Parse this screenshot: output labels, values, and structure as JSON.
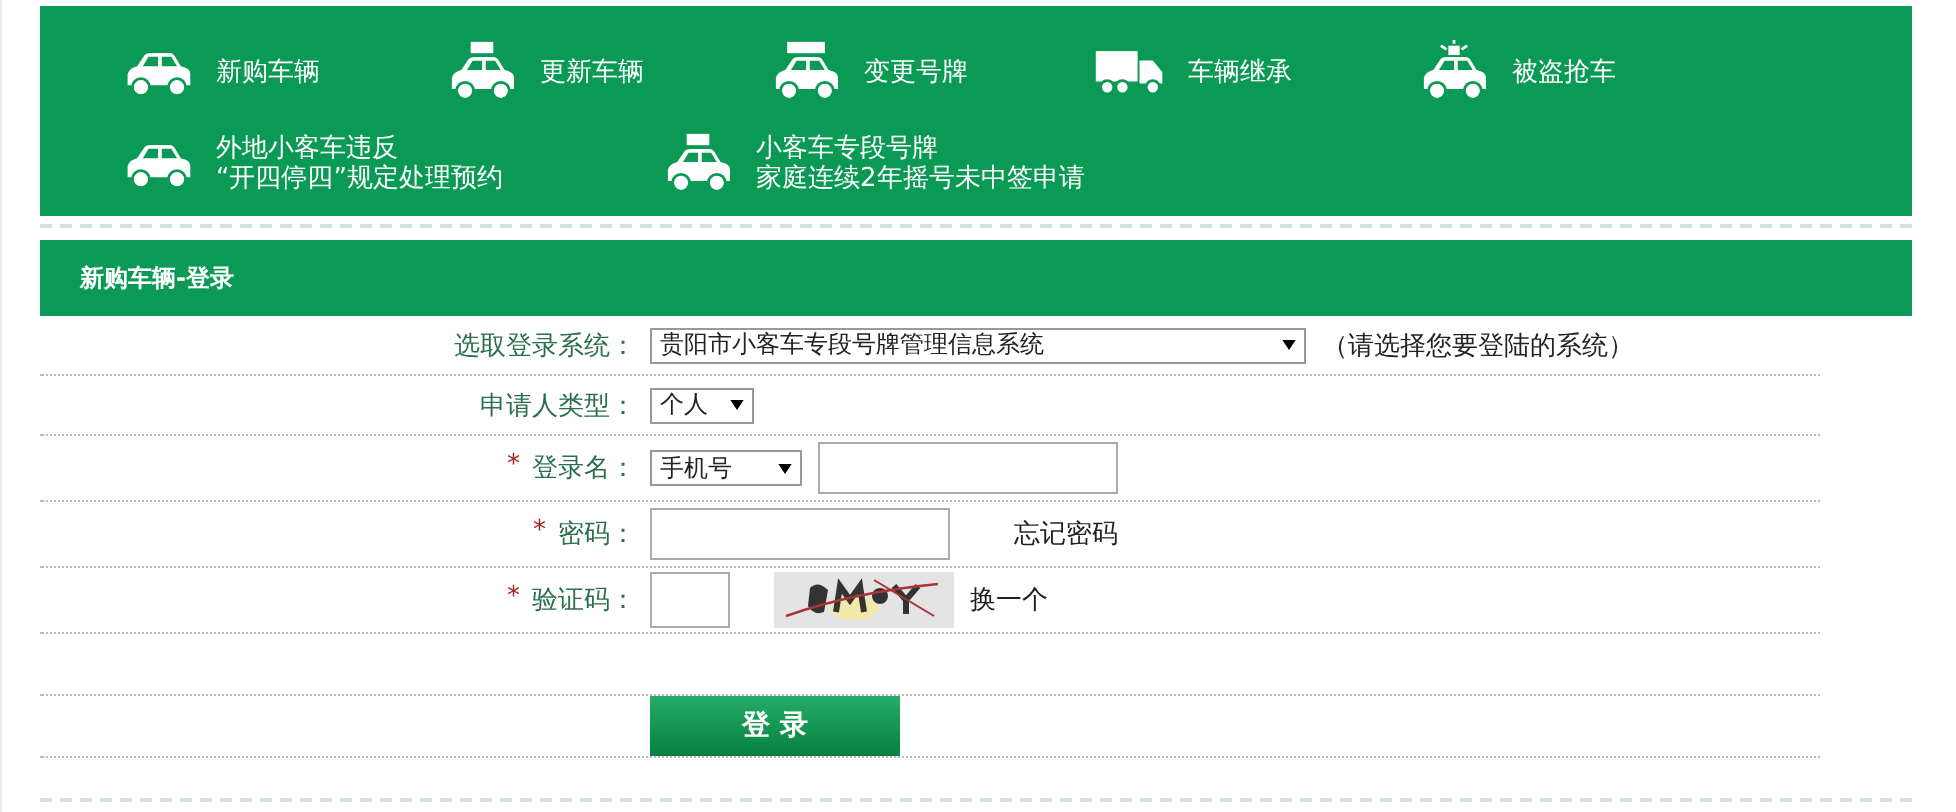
{
  "nav": {
    "items": [
      {
        "kind": "car",
        "lines": [
          "新购车辆"
        ]
      },
      {
        "kind": "taxi",
        "lines": [
          "更新车辆"
        ]
      },
      {
        "kind": "sign-car",
        "lines": [
          "变更号牌"
        ]
      },
      {
        "kind": "truck",
        "lines": [
          "车辆继承"
        ]
      },
      {
        "kind": "police",
        "lines": [
          "被盗抢车"
        ]
      },
      {
        "kind": "car",
        "lines": [
          "外地小客车违反",
          "“开四停四”规定处理预约"
        ]
      },
      {
        "kind": "taxi",
        "lines": [
          "小客车专段号牌",
          "家庭连续2年摇号未中签申请"
        ]
      }
    ]
  },
  "panel": {
    "title": "新购车辆-登录"
  },
  "form": {
    "rows": [
      {
        "kind": "select",
        "label": "选取登录系统：",
        "select": "贵阳市小客车专段号牌管理信息系统",
        "hint": "（请选择您要登陆的系统）"
      },
      {
        "kind": "select",
        "label": "申请人类型：",
        "select": "个人"
      },
      {
        "kind": "select-input",
        "mark": "*",
        "label": "登录名：",
        "select": "手机号"
      },
      {
        "kind": "password",
        "mark": "*",
        "label": "密码：",
        "link": "忘记密码"
      },
      {
        "kind": "captcha",
        "mark": "*",
        "label": "验证码：",
        "link": "换一个"
      },
      {
        "kind": "blank"
      }
    ],
    "button": "登 录"
  }
}
